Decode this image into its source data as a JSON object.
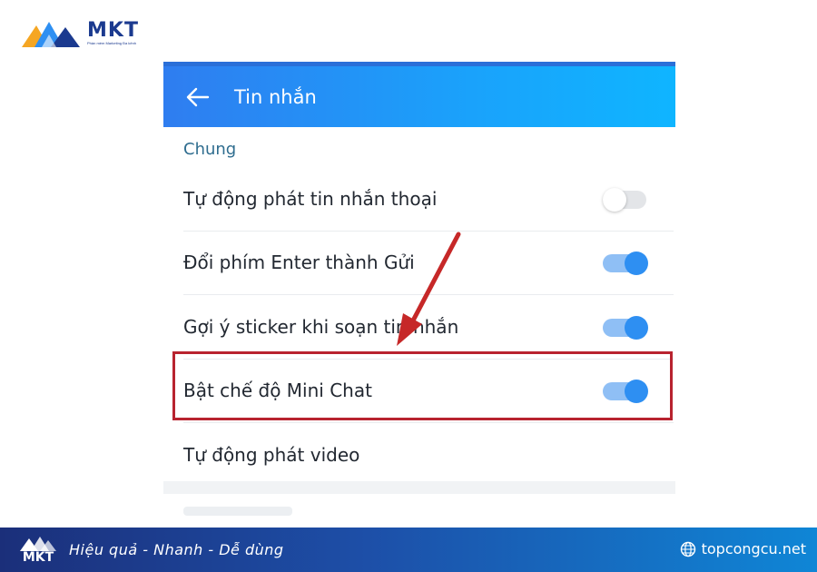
{
  "brand": {
    "name": "MKT",
    "tagline": "Phần mềm Marketing Đa kênh",
    "colors": {
      "primary": "#1b3a8f",
      "accent": "#f5a623"
    }
  },
  "appbar": {
    "title": "Tin nhắn",
    "back_icon": "arrow-left-icon",
    "color": "#1aa2fb"
  },
  "section": {
    "title": "Chung"
  },
  "settings": [
    {
      "label": "Tự động phát tin nhắn thoại",
      "has_toggle": true,
      "enabled": false
    },
    {
      "label": "Đổi phím Enter thành Gửi",
      "has_toggle": true,
      "enabled": true
    },
    {
      "label": "Gợi ý sticker khi soạn tin nhắn",
      "has_toggle": true,
      "enabled": true
    },
    {
      "label": "Bật chế độ Mini Chat",
      "has_toggle": true,
      "enabled": true,
      "highlighted": true
    },
    {
      "label": "Tự động phát video",
      "has_toggle": false
    }
  ],
  "annotation": {
    "highlight_color": "#b8232f",
    "arrow_icon": "red-arrow-icon"
  },
  "footer": {
    "logo_text": "MKT",
    "slogan": "Hiệu quả - Nhanh  - Dễ dùng",
    "website": "topcongcu.net",
    "website_icon": "globe-icon"
  }
}
